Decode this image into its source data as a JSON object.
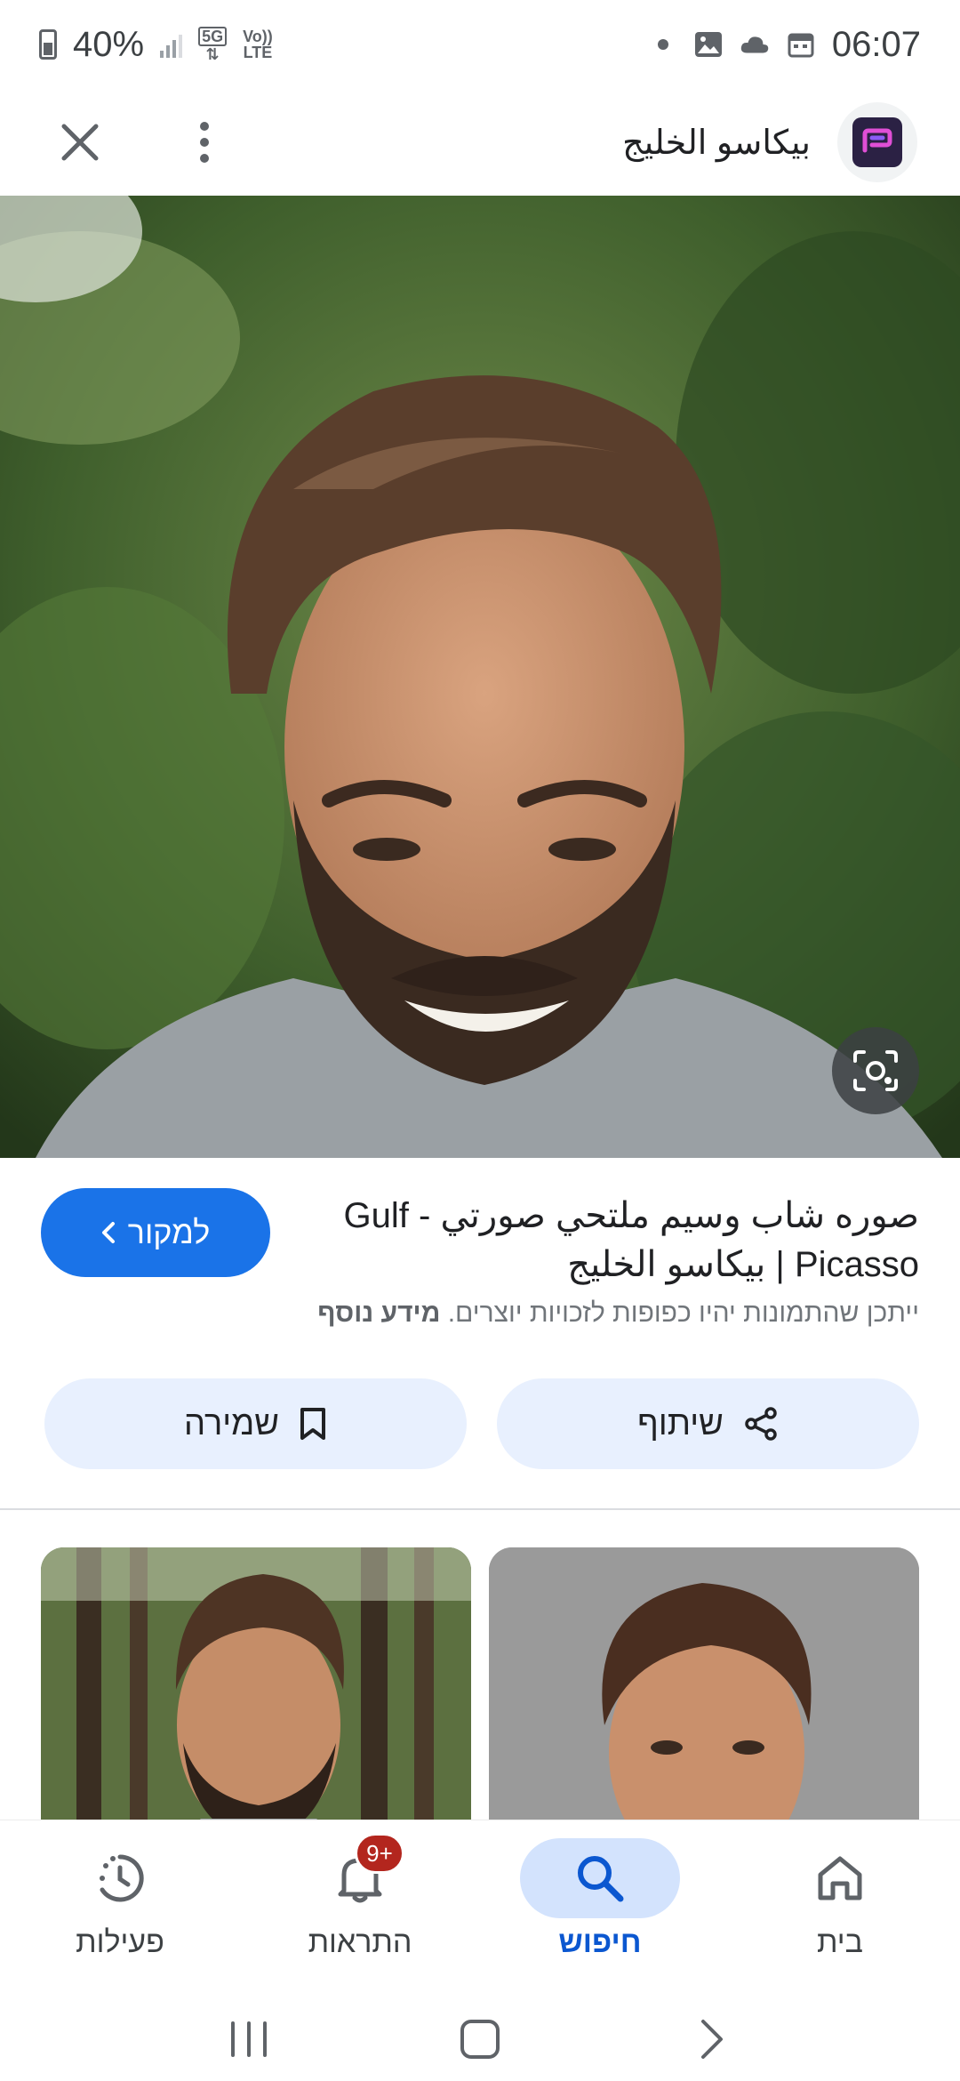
{
  "status_bar": {
    "battery": "40%",
    "network": "5G",
    "volte_top": "Vo))",
    "volte_bottom": "LTE",
    "time": "06:07"
  },
  "header": {
    "site_name": "بيكاسو الخليج"
  },
  "result": {
    "title": "صوره شاب وسيم ملتحي صورتي - Gulf Picasso | بيكاسو الخليج",
    "source_button": "למקור",
    "copyright_notice": "ייתכן שהתמונות יהיו כפופות לזכויות יוצרים.",
    "more_info": "מידע נוסף",
    "save_button": "שמירה",
    "share_button": "שיתוף"
  },
  "bottom_nav": {
    "items": [
      {
        "label": "פעילות",
        "icon": "activity-icon"
      },
      {
        "label": "התראות",
        "icon": "bell-icon",
        "badge": "9+"
      },
      {
        "label": "חיפוש",
        "icon": "search-icon",
        "active": true
      },
      {
        "label": "בית",
        "icon": "home-icon"
      }
    ]
  },
  "colors": {
    "accent": "#1a73e8",
    "pill": "#e8f0fe",
    "active_nav": "#d3e3fd",
    "badge": "#b3261e"
  }
}
